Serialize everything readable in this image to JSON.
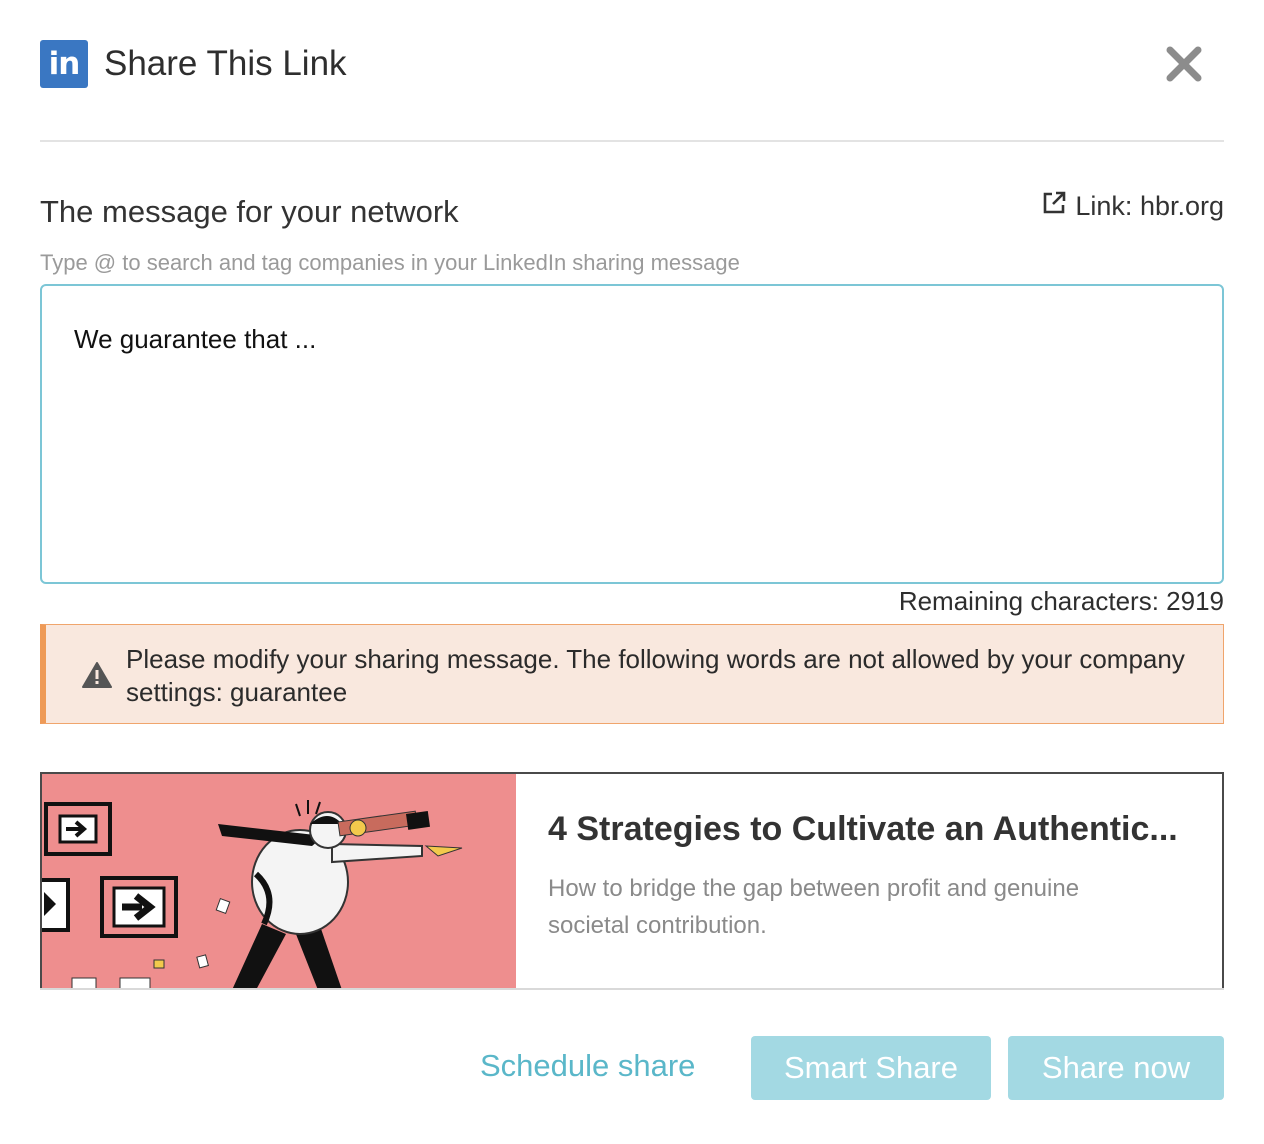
{
  "header": {
    "logo_text": "in",
    "title": "Share This Link",
    "close_icon": "close-icon"
  },
  "message": {
    "label": "The message for your network",
    "link_label": "Link: hbr.org",
    "hint": "Type @ to search and tag companies in your LinkedIn sharing message",
    "value": "We guarantee that ...",
    "remaining": "Remaining characters: 2919"
  },
  "alert": {
    "icon": "warning-icon",
    "text": "Please modify your sharing message. The following words are not allowed by your company settings: guarantee",
    "color": "#ee9a57"
  },
  "preview": {
    "title": "4 Strategies to Cultivate an Authentic...",
    "description": "How to bridge the gap between profit and genuine societal contribution.",
    "image": "illustration-man-with-telescope"
  },
  "footer": {
    "schedule_label": "Schedule share",
    "smart_share_label": "Smart Share",
    "share_now_label": "Share now"
  },
  "colors": {
    "accent": "#5ab7c9",
    "button_disabled": "#a3d9e3",
    "linkedin": "#3a77c2",
    "alert_bg": "#f9e8de"
  }
}
